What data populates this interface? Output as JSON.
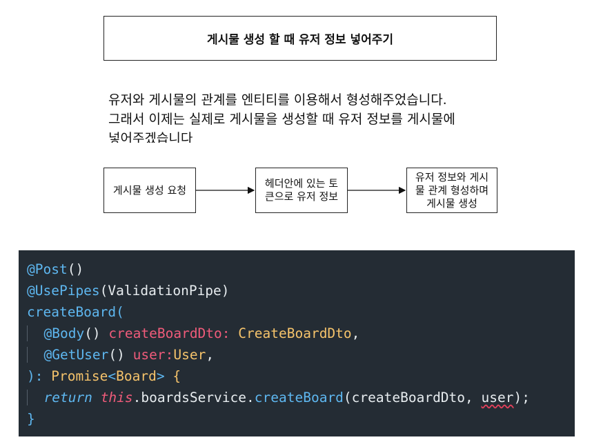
{
  "title": "게시물 생성 할 때 유저 정보 넣어주기",
  "paragraph": [
    "유저와 게시물의 관계를 엔티티를 이용해서 형성해주었습니다.",
    "그래서 이제는 실제로 게시물을 생성할 때 유저 정보를 게시물에",
    "넣어주겠습니다"
  ],
  "flow": {
    "nodes": [
      {
        "label": "게시물 생성 요청"
      },
      {
        "label": "헤더안에 있는 토큰으로 유저 정보"
      },
      {
        "label": "유저 정보와 게시물 관계 형성하며 게시물 생성"
      }
    ]
  },
  "code": {
    "line1": {
      "dec": "@Post",
      "rest": "()"
    },
    "line2": {
      "dec": "@UsePipes",
      "open": "(",
      "arg": "ValidationPipe",
      "close": ")"
    },
    "line3": {
      "fn": "createBoard",
      "open": "("
    },
    "line4": {
      "dec": "@Body",
      "parens": "()",
      "param": "createBoardDto",
      "colon": ":",
      "type": "CreateBoardDto",
      "comma": ","
    },
    "line5": {
      "dec": "@GetUser",
      "parens": "()",
      "param": "user",
      "colon": ":",
      "type": "User",
      "comma": ","
    },
    "line6": {
      "close": "):",
      "type": "Promise",
      "lt": "<",
      "generic": "Board",
      "gt": ">",
      "brace": "{"
    },
    "line7": {
      "kw": "return",
      "this": "this",
      "dot1": ".boardsService",
      "dot2": ".",
      "method": "createBoard",
      "open": "(",
      "arg1": "createBoardDto",
      "sep": ", ",
      "arg2": "user",
      "close": ");"
    },
    "line8": {
      "brace": "}"
    }
  }
}
